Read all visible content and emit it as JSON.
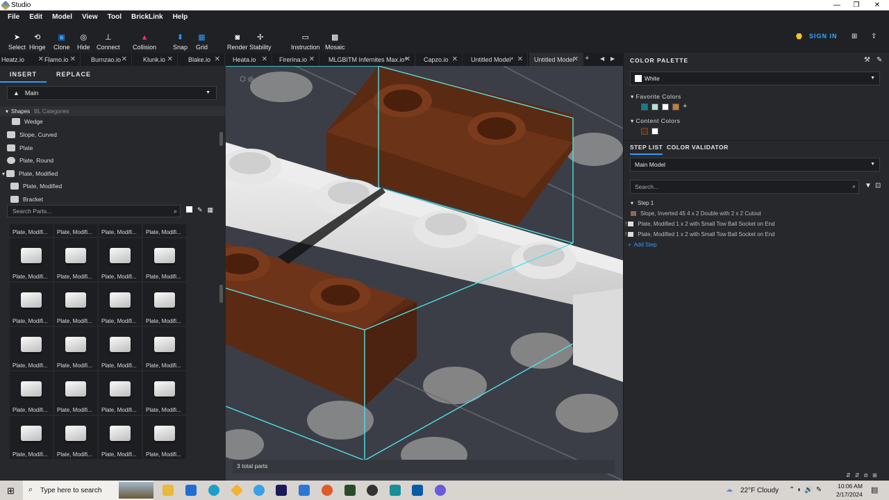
{
  "window": {
    "title": "Studio",
    "minimize": "—",
    "restore": "❐",
    "close": "✕"
  },
  "menu": [
    "File",
    "Edit",
    "Model",
    "View",
    "Tool",
    "BrickLink",
    "Help"
  ],
  "toolbar": [
    {
      "label": "Select",
      "icon": "pointer-icon",
      "glyph": "➤"
    },
    {
      "label": "Hinge",
      "icon": "hinge-icon",
      "glyph": "⟲"
    },
    {
      "label": "Clone",
      "icon": "clone-icon",
      "glyph": "▣"
    },
    {
      "label": "Hide",
      "icon": "eye-off-icon",
      "glyph": "◎"
    },
    {
      "label": "Connect",
      "icon": "connect-icon",
      "glyph": "⊥"
    },
    {
      "label": "Collision",
      "icon": "collision-icon",
      "glyph": "▲"
    },
    {
      "label": "Snap",
      "icon": "magnet-icon",
      "glyph": "⬍"
    },
    {
      "label": "Grid",
      "icon": "grid-icon",
      "glyph": "▦"
    },
    {
      "label": "Render",
      "icon": "camera-icon",
      "glyph": "◙"
    },
    {
      "label": "Stability",
      "icon": "stability-icon",
      "glyph": "✢"
    },
    {
      "label": "Instruction",
      "icon": "instruction-icon",
      "glyph": "▭"
    },
    {
      "label": "Mosaic",
      "icon": "mosaic-icon",
      "glyph": "▩"
    }
  ],
  "signin": "SIGN IN",
  "tabs": [
    "Heatz.io",
    "Flamo.io",
    "Burnzao.io",
    "Klunk.io",
    "Blake.io",
    "Heata.io",
    "Firerina.io",
    "MLGBITM Infernites Max.io*",
    "Capzo.io",
    "Untitled Model*",
    "Untitled Model"
  ],
  "left": {
    "tab_insert": "INSERT",
    "tab_replace": "REPLACE",
    "palette": "Main",
    "shapes": "Shapes",
    "bl_categories": "BL Categories",
    "tree": [
      "Wedge",
      "Slope, Curved",
      "Plate",
      "Plate, Round",
      "Plate, Modified",
      "Plate, Modified",
      "Bracket"
    ],
    "search_placeholder": "Search Parts...",
    "part_label": "Plate, Modifi..."
  },
  "viewport": {
    "total_parts": "3 total parts"
  },
  "right": {
    "color_palette": "COLOR PALETTE",
    "selected_color": "White",
    "favorite_colors": "Favorite Colors",
    "favorites": [
      "#0e7f8a",
      "#b7dede",
      "#ffffff",
      "#c77b3b"
    ],
    "content_colors": "Content Colors",
    "content": [
      "#5a2a14",
      "#ffffff"
    ],
    "tab_steps": "STEP LIST",
    "tab_validator": "COLOR VALIDATOR",
    "model": "Main Model",
    "search_placeholder": "Search...",
    "step": "Step 1",
    "step_items": [
      "Slope, Inverted 45 4 x 2 Double with 2 x 2 Cutout",
      "Plate, Modified 1 x 2 with Small Tow Ball Socket on End",
      "Plate, Modified 1 x 2 with Small Tow Ball Socket on End"
    ],
    "add_step": "Add Step"
  },
  "taskbar": {
    "search": "Type here to search",
    "weather": "22°F  Cloudy",
    "time": "10:06 AM",
    "date": "2/17/2024"
  }
}
